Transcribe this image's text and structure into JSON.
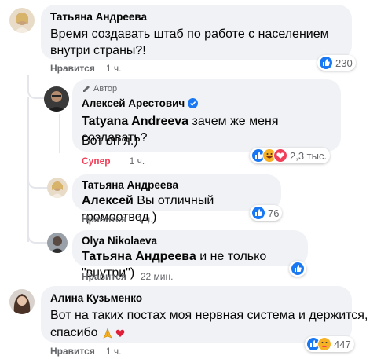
{
  "comments": [
    {
      "author": "Татьяна Андреева",
      "text": "Время создавать штаб по работе с населением внутри страны?!",
      "action": "Нравится",
      "time": "1 ч.",
      "reaction_count": "230"
    },
    {
      "badge": "Автор",
      "author": "Алексей Арестович",
      "tag": "Tatyana Andreeva",
      "text": " зачем же меня создавать?",
      "text2": "Вот он я.)",
      "action": "Супер",
      "time": "1 ч.",
      "reaction_count": "2,3 тыс."
    },
    {
      "author": "Татьяна Андреева",
      "tag": "Алексей",
      "text": " Вы отличный громоотвод )",
      "action": "Нравится",
      "time": "1 ч.",
      "reaction_count": "76"
    },
    {
      "author": "Olya Nikolaeva",
      "tag": "Татьяна Андреева",
      "text": " и не только \"внутри\")",
      "action": "Нравится",
      "time": "22 мин."
    },
    {
      "author": "Алина Кузьменко",
      "text": "Вот на таких постах моя нервная система и держится,",
      "text2": "спасибо",
      "action": "Нравится",
      "time": "1 ч.",
      "reaction_count": "447"
    }
  ]
}
